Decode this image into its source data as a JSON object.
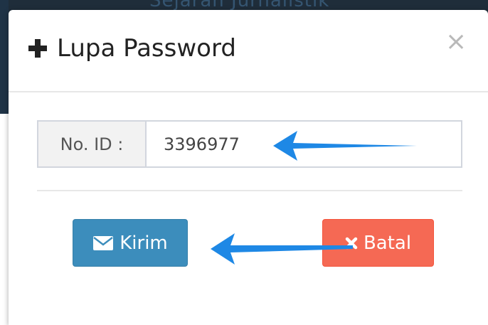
{
  "background_title": "Sejarah Jurnalistik",
  "modal": {
    "title": "Lupa Password",
    "close_glyph": "×"
  },
  "form": {
    "id_label": "No. ID :",
    "id_value": "3396977"
  },
  "buttons": {
    "submit_label": "Kirim",
    "cancel_label": "Batal"
  },
  "icons": {
    "title": "plus-icon",
    "close": "close-icon",
    "submit": "envelope-icon",
    "cancel": "times-icon"
  },
  "colors": {
    "submit": "#3c8dbc",
    "cancel": "#f56954",
    "annotation_arrow": "#1e88e5"
  }
}
